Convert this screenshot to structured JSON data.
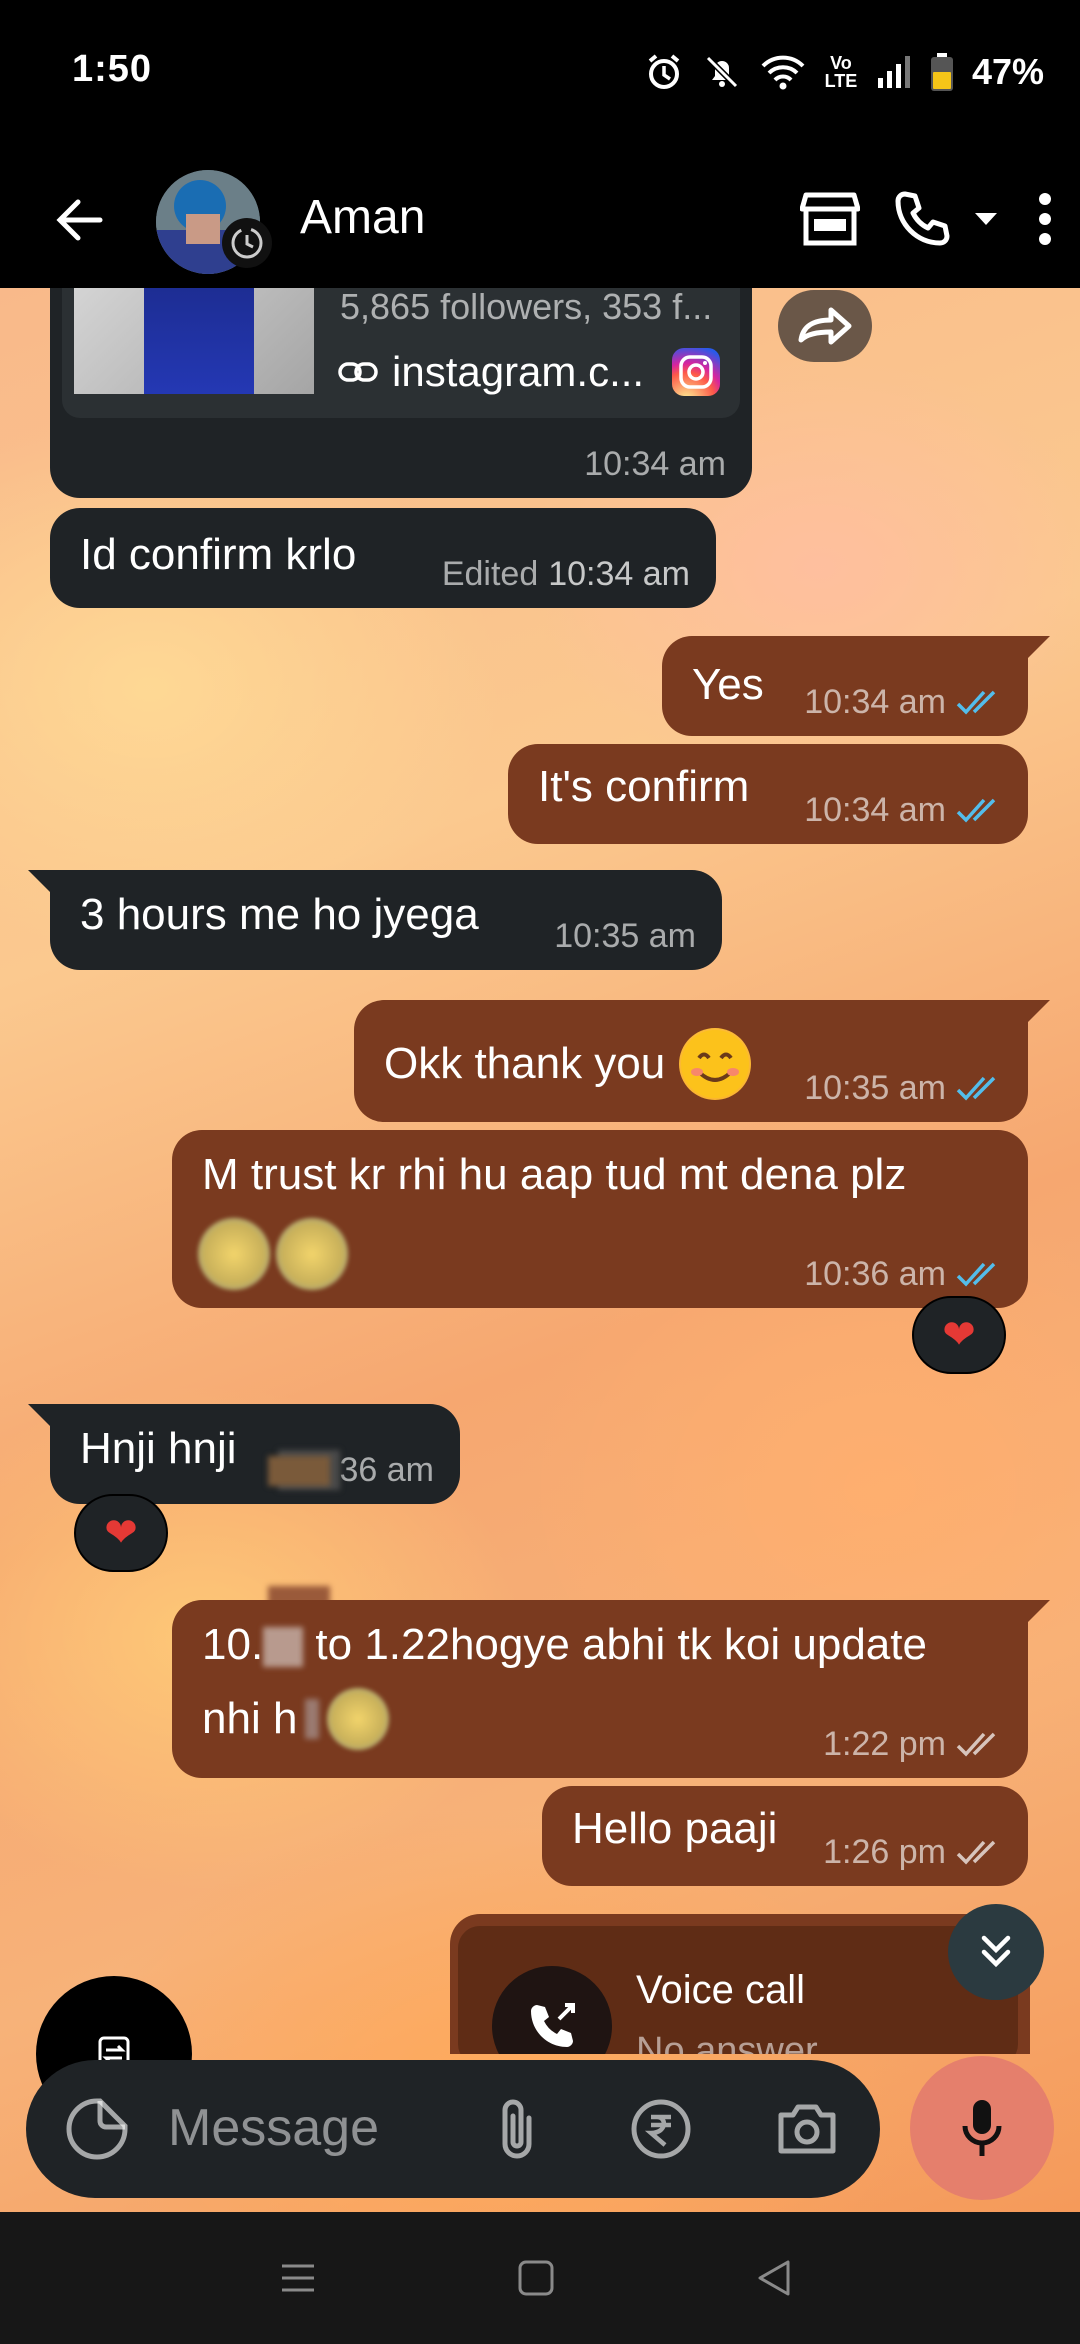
{
  "status_bar": {
    "time": "1:50",
    "battery": "47%",
    "network": "Vo LTE"
  },
  "header": {
    "contact_name": "Aman"
  },
  "link_preview": {
    "followers": "5,865 followers, 353 f...",
    "link": "instagram.c...",
    "time": "10:34 am"
  },
  "messages": [
    {
      "dir": "in",
      "text": "Id confirm krlo",
      "edited": "Edited",
      "time": "10:34 am"
    },
    {
      "dir": "out",
      "text": "Yes",
      "time": "10:34 am"
    },
    {
      "dir": "out",
      "text": "It's confirm",
      "time": "10:34 am"
    },
    {
      "dir": "in",
      "text": "3 hours me ho jyega",
      "time": "10:35 am"
    },
    {
      "dir": "out",
      "text": "Okk thank you",
      "time": "10:35 am"
    },
    {
      "dir": "out",
      "text": "M trust kr rhi hu aap tud mt dena plz",
      "time": "10:36 am"
    },
    {
      "dir": "in",
      "text": "Hnji hnji",
      "time": "36 am"
    },
    {
      "dir": "out",
      "text_a": "10.",
      "text_b": " to 1.22hogye abhi tk koi update",
      "text_c": "nhi h",
      "time": "1:22 pm"
    },
    {
      "dir": "out",
      "text": "Hello paaji",
      "time": "1:26 pm"
    }
  ],
  "reactions": {
    "heart": "❤"
  },
  "voice_call": {
    "title": "Voice call",
    "subtitle": "No answer"
  },
  "composer": {
    "placeholder": "Message"
  },
  "colors": {
    "incoming": "#1f2326",
    "outgoing": "#7a3a1f",
    "read_tick": "#53bdeb",
    "mic": "#e57f6c"
  }
}
